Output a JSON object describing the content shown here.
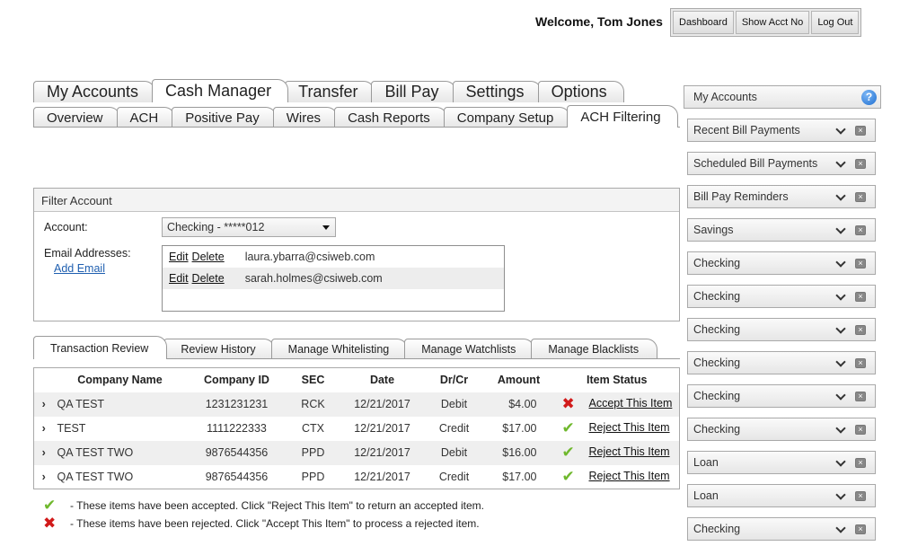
{
  "header": {
    "welcome": "Welcome, Tom Jones",
    "buttons": [
      "Dashboard",
      "Show Acct No",
      "Log Out"
    ]
  },
  "main_tabs": [
    "My Accounts",
    "Cash Manager",
    "Transfer",
    "Bill Pay",
    "Settings",
    "Options"
  ],
  "main_tab_active": "Cash Manager",
  "sub_tabs": [
    "Overview",
    "ACH",
    "Positive Pay",
    "Wires",
    "Cash Reports",
    "Company Setup",
    "ACH Filtering"
  ],
  "sub_tab_active": "ACH Filtering",
  "filter": {
    "title": "Filter Account",
    "account_label": "Account:",
    "account_value": "Checking - *****012",
    "email_label": "Email Addresses:",
    "add_email": "Add Email",
    "edit_label": "Edit",
    "delete_label": "Delete",
    "emails": [
      "laura.ybarra@csiweb.com",
      "sarah.holmes@csiweb.com"
    ]
  },
  "tx_tabs": [
    "Transaction Review",
    "Review History",
    "Manage Whitelisting",
    "Manage Watchlists",
    "Manage Blacklists"
  ],
  "tx_tab_active": "Transaction Review",
  "table": {
    "columns": [
      "Company Name",
      "Company ID",
      "SEC",
      "Date",
      "Dr/Cr",
      "Amount",
      "Item Status"
    ],
    "rows": [
      {
        "name": "QA TEST",
        "id": "1231231231",
        "sec": "RCK",
        "date": "12/21/2017",
        "drcr": "Debit",
        "amount": "$4.00",
        "status": "rejected",
        "action": "Accept This Item"
      },
      {
        "name": "TEST",
        "id": "1111222333",
        "sec": "CTX",
        "date": "12/21/2017",
        "drcr": "Credit",
        "amount": "$17.00",
        "status": "accepted",
        "action": "Reject This Item"
      },
      {
        "name": "QA TEST TWO",
        "id": "9876544356",
        "sec": "PPD",
        "date": "12/21/2017",
        "drcr": "Debit",
        "amount": "$16.00",
        "status": "accepted",
        "action": "Reject This Item"
      },
      {
        "name": "QA TEST TWO",
        "id": "9876544356",
        "sec": "PPD",
        "date": "12/21/2017",
        "drcr": "Credit",
        "amount": "$17.00",
        "status": "accepted",
        "action": "Reject This Item"
      }
    ]
  },
  "legend": {
    "accepted": "- These items have been accepted. Click \"Reject This Item\" to return an accepted item.",
    "rejected": "- These items have been rejected. Click \"Accept This Item\" to process a rejected item."
  },
  "icons": {
    "expand": "chevron-right-icon",
    "accepted": "check-icon",
    "rejected": "x-icon",
    "help": "help-icon",
    "collapse": "chevron-down-icon",
    "close": "close-icon"
  },
  "colors": {
    "accepted": "#6fb82d",
    "rejected": "#d11a1a",
    "link": "#1f5fb0",
    "help": "#1f6fd1"
  },
  "sidebar": {
    "title": "My Accounts",
    "help": "?",
    "items": [
      "Recent Bill Payments",
      "Scheduled Bill Payments",
      "Bill Pay Reminders",
      "Savings",
      "Checking",
      "Checking",
      "Checking",
      "Checking",
      "Checking",
      "Checking",
      "Loan",
      "Loan",
      "Checking"
    ]
  }
}
